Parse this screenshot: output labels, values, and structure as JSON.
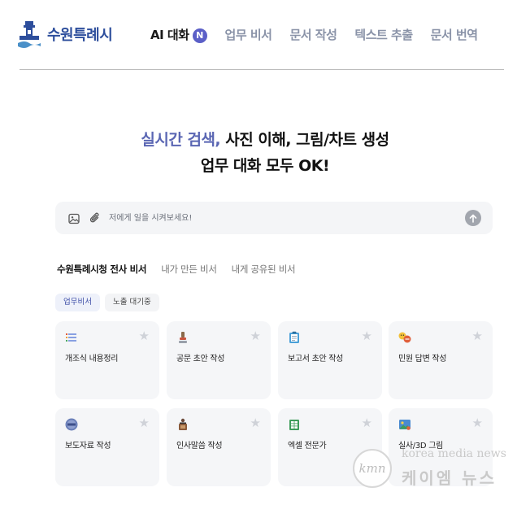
{
  "header": {
    "logo_text": "수원특례시",
    "nav": [
      {
        "label": "AI 대화",
        "badge": "N",
        "active": true
      },
      {
        "label": "업무 비서"
      },
      {
        "label": "문서 작성"
      },
      {
        "label": "텍스트 추출"
      },
      {
        "label": "문서 번역"
      }
    ]
  },
  "hero": {
    "line1_accent": "실시간 검색,",
    "line1_rest": " 사진 이해, 그림/차트 생성",
    "line2": "업무 대화 모두 OK!"
  },
  "search": {
    "placeholder": "저에게 일을 시켜보세요!",
    "value": ""
  },
  "tabs": [
    "수원특례시청 전사 비서",
    "내가 만든 비서",
    "내게 공유된 비서"
  ],
  "chips": [
    "업무비서",
    "노출 대기중"
  ],
  "cards": [
    {
      "label": "개조식 내용정리",
      "icon": "list-icon"
    },
    {
      "label": "공문 초안 작성",
      "icon": "stamp-icon"
    },
    {
      "label": "보고서 초안 작성",
      "icon": "clipboard-icon"
    },
    {
      "label": "민원 답변 작성",
      "icon": "complaint-icon"
    },
    {
      "label": "보도자료 작성",
      "icon": "news-icon"
    },
    {
      "label": "인사말씀 작성",
      "icon": "podium-icon"
    },
    {
      "label": "엑셀 전문가",
      "icon": "spreadsheet-icon"
    },
    {
      "label": "실사/3D 그림",
      "icon": "picture-icon"
    }
  ],
  "watermark": {
    "logo": "kmn",
    "en": "korea media news",
    "ko": "케이엠 뉴스"
  },
  "colors": {
    "brand": "#2d4e9c",
    "accent": "#5a66b3",
    "badge": "#5b5fc7"
  }
}
